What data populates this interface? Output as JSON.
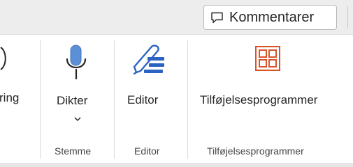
{
  "top_bar": {
    "comments_label": "Kommentarer"
  },
  "ribbon": {
    "partial_button_label": "ring",
    "dictate": {
      "label": "Dikter",
      "group_label": "Stemme"
    },
    "editor": {
      "label": "Editor",
      "group_label": "Editor"
    },
    "addins": {
      "label": "Tilføjelsesprogrammer",
      "group_label": "Tilføjelsesprogrammer"
    }
  },
  "colors": {
    "mic_blue": "#5b8fd6",
    "editor_blue": "#2b63c4",
    "addins_orange": "#d9532b"
  },
  "icons": {
    "comments": "comment-icon",
    "dictate": "microphone-icon",
    "editor": "pen-icon",
    "addins": "addins-grid-icon",
    "dropdown": "chevron-down-icon"
  }
}
